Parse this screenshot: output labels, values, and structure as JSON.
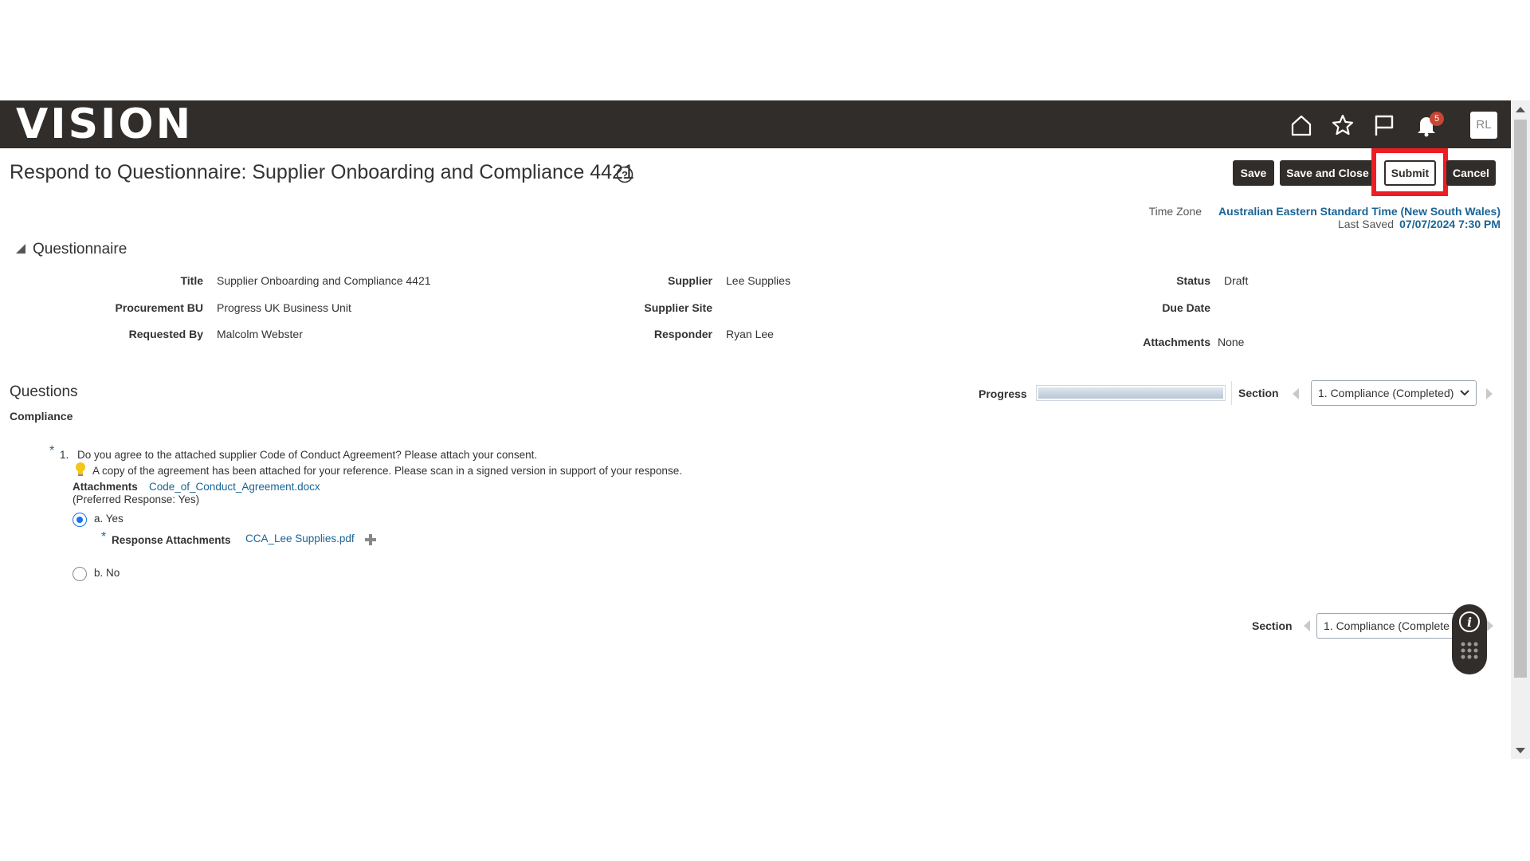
{
  "header": {
    "logo_text": "VISION",
    "notification_count": "5",
    "user_initials": "RL",
    "icons": [
      "home-icon",
      "star-icon",
      "flag-icon",
      "bell-icon"
    ]
  },
  "page": {
    "title": "Respond to Questionnaire: Supplier Onboarding and Compliance 4421",
    "buttons": {
      "save": "Save",
      "save_and_close": "Save and Close",
      "submit": "Submit",
      "cancel": "Cancel"
    },
    "time_zone_label": "Time Zone",
    "time_zone_value": "Australian Eastern Standard Time (New South Wales)",
    "last_saved_label": "Last Saved",
    "last_saved_value": "07/07/2024 7:30 PM"
  },
  "questionnaire": {
    "heading": "Questionnaire",
    "fields": {
      "title_label": "Title",
      "title_value": "Supplier Onboarding and Compliance 4421",
      "procurement_bu_label": "Procurement BU",
      "procurement_bu_value": "Progress UK Business Unit",
      "requested_by_label": "Requested By",
      "requested_by_value": "Malcolm Webster",
      "supplier_label": "Supplier",
      "supplier_value": "Lee Supplies",
      "supplier_site_label": "Supplier Site",
      "supplier_site_value": "",
      "responder_label": "Responder",
      "responder_value": "Ryan Lee",
      "status_label": "Status",
      "status_value": "Draft",
      "due_date_label": "Due Date",
      "due_date_value": "",
      "attachments_label": "Attachments",
      "attachments_value": "None"
    }
  },
  "questions": {
    "heading": "Questions",
    "section_name": "Compliance",
    "progress_label": "Progress",
    "progress_fraction": 1.0,
    "section_label": "Section",
    "section_selected": "1. Compliance (Completed)",
    "items": [
      {
        "number": "1.",
        "text": "Do you agree to the attached supplier Code of Conduct Agreement?  Please attach your consent.",
        "hint": "A copy of the agreement has been attached for your reference. Please scan in a signed version in support of your response.",
        "attachments_label": "Attachments",
        "attachment_file": "Code_of_Conduct_Agreement.docx",
        "preferred_response": "(Preferred Response: Yes)",
        "options": [
          {
            "label": "a. Yes",
            "selected": true
          },
          {
            "label": "b. No",
            "selected": false
          }
        ],
        "response_attachments_label": "Response Attachments",
        "response_attachment_file": "CCA_Lee Supplies.pdf"
      }
    ],
    "bottom_section_selected": "1. Compliance (Complete"
  },
  "colors": {
    "header_bg": "#312d2a",
    "link": "#1a6496",
    "highlight": "#ee1d24",
    "badge": "#c74634"
  }
}
